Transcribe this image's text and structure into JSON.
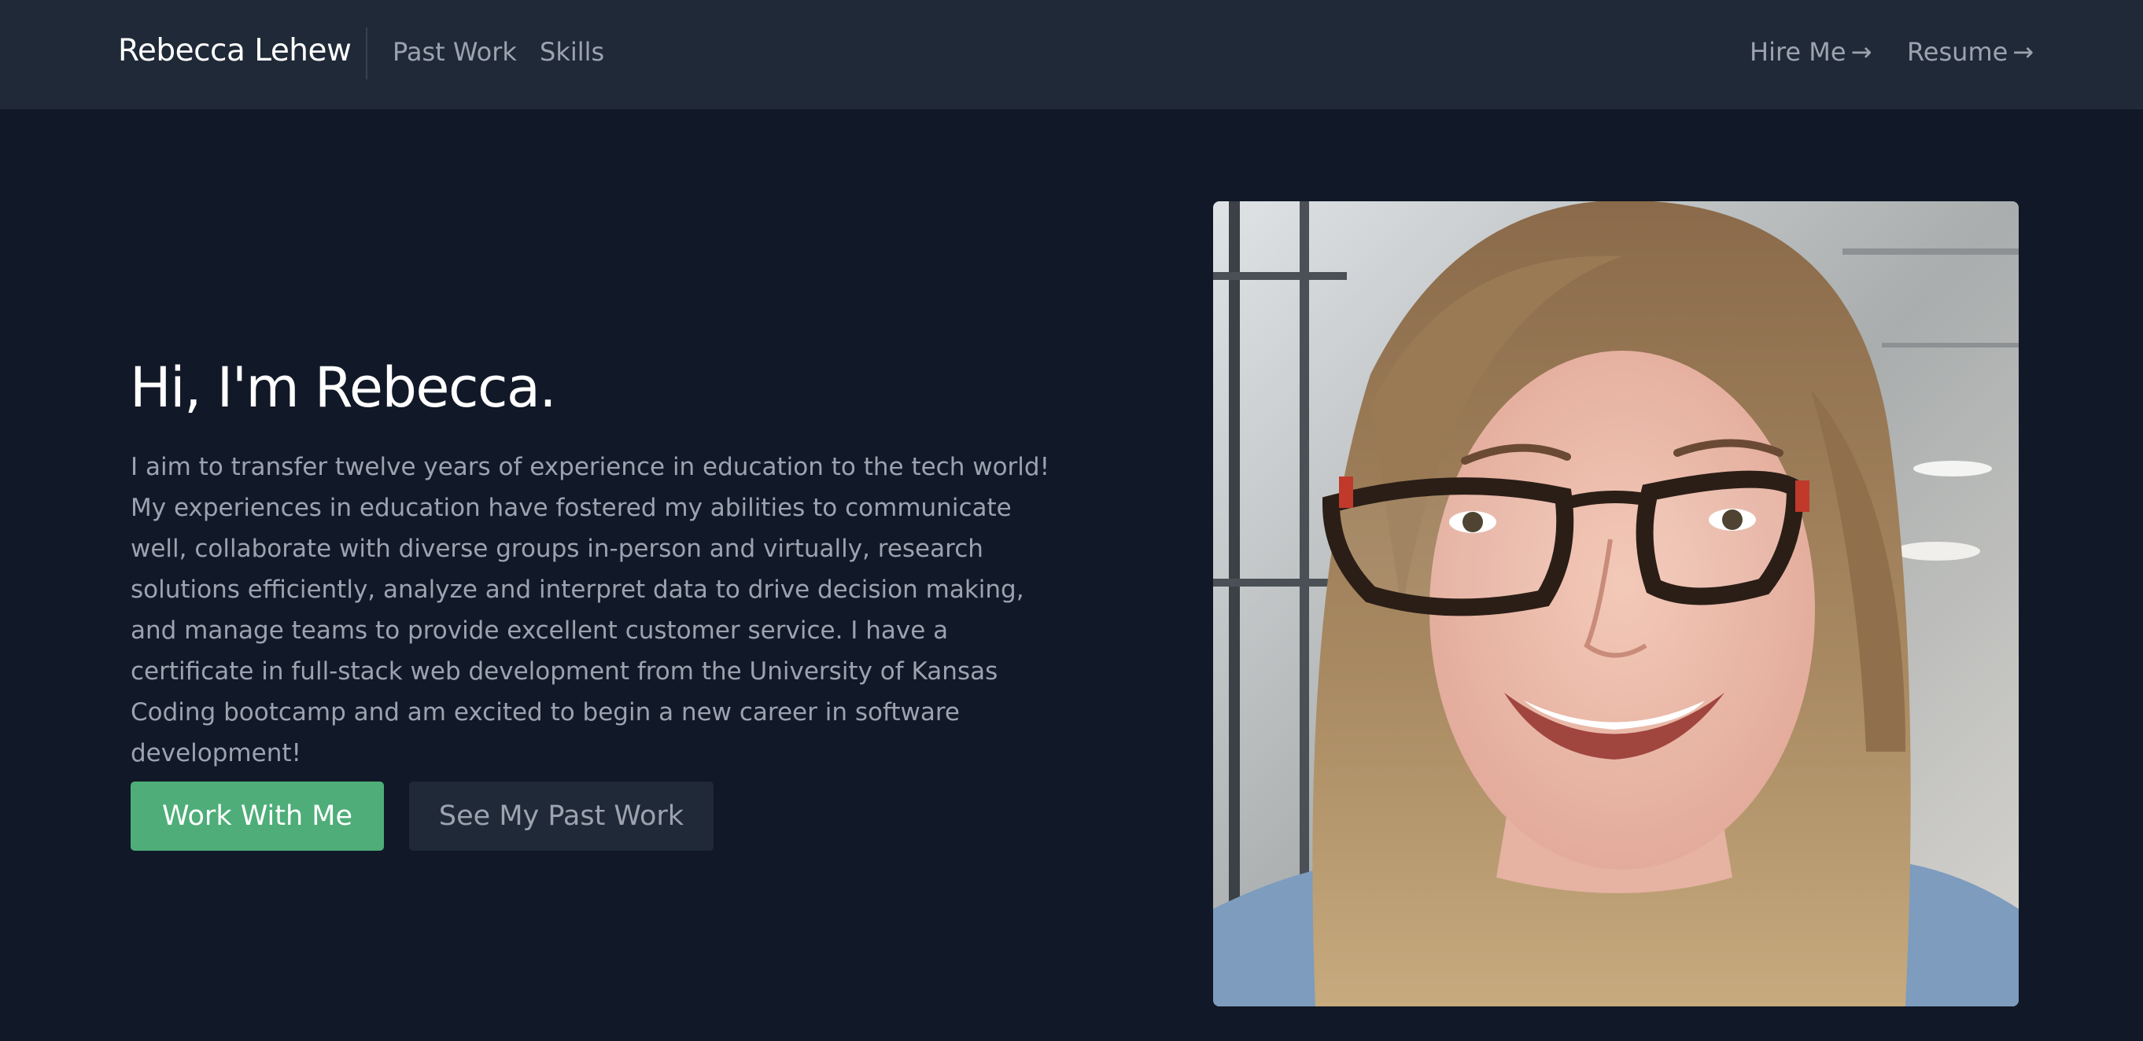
{
  "nav": {
    "brand": "Rebecca Lehew",
    "links": [
      "Past Work",
      "Skills"
    ],
    "hire_label": "Hire Me",
    "resume_label": "Resume",
    "arrow": "→"
  },
  "hero": {
    "title": "Hi, I'm Rebecca.",
    "paragraph": "I aim to transfer twelve years of experience in education to the tech world! My experiences in education have fostered my abilities to communicate well, collaborate with diverse groups in-person and virtually, research solutions efficiently, analyze and interpret data to drive decision making, and manage teams to provide excellent customer service. I have a certificate in full-stack web development from the University of Kansas Coding bootcamp and am excited to begin a new career in software development!",
    "primary_button": "Work With Me",
    "secondary_button": "See My Past Work"
  },
  "colors": {
    "background": "#111827",
    "navbar": "#1f2937",
    "accent": "#4ead78",
    "muted_text": "#9ca3af"
  }
}
